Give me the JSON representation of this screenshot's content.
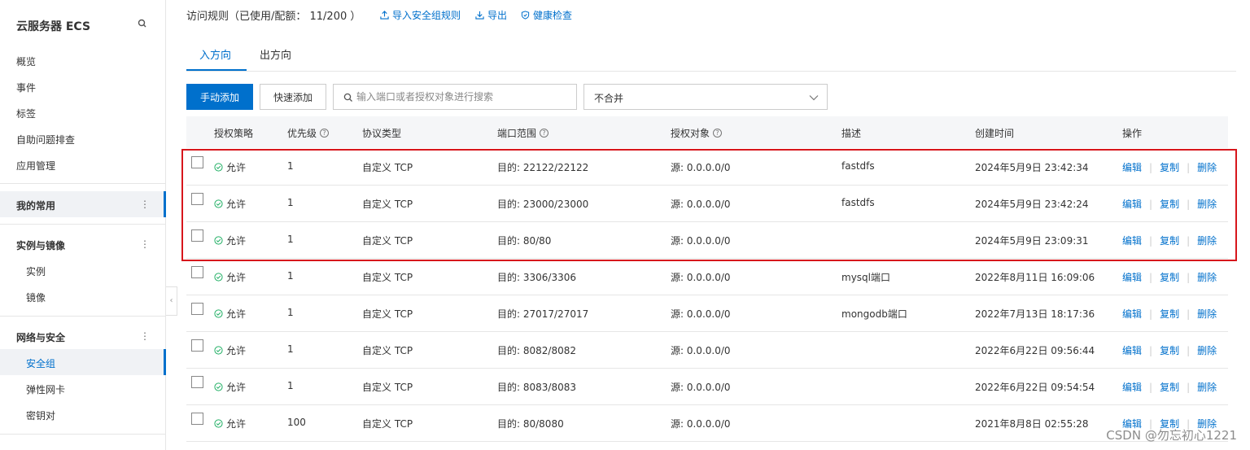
{
  "sidebar": {
    "title": "云服务器 ECS",
    "items": [
      "概览",
      "事件",
      "标签",
      "自助问题排查",
      "应用管理"
    ],
    "favorites": "我的常用",
    "group1": {
      "label": "实例与镜像",
      "items": [
        "实例",
        "镜像"
      ]
    },
    "group2": {
      "label": "网络与安全",
      "items": [
        "安全组",
        "弹性网卡",
        "密钥对"
      ]
    }
  },
  "header": {
    "title": "访问规则（已使用/配额： 11/200 ）",
    "links": [
      "导入安全组规则",
      "导出",
      "健康检查"
    ]
  },
  "tabs": [
    "入方向",
    "出方向"
  ],
  "toolbar": {
    "add_manual": "手动添加",
    "add_quick": "快速添加",
    "search_placeholder": "输入端口或者授权对象进行搜索",
    "merge_select": "不合并"
  },
  "table": {
    "headers": [
      "授权策略",
      "优先级",
      "协议类型",
      "端口范围",
      "授权对象",
      "描述",
      "创建时间",
      "操作"
    ],
    "actions": [
      "编辑",
      "复制",
      "删除"
    ],
    "rows": [
      {
        "policy": "允许",
        "priority": "1",
        "protocol": "自定义 TCP",
        "port": "目的: 22122/22122",
        "source": "源: 0.0.0.0/0",
        "desc": "fastdfs",
        "time": "2024年5月9日 23:42:34"
      },
      {
        "policy": "允许",
        "priority": "1",
        "protocol": "自定义 TCP",
        "port": "目的: 23000/23000",
        "source": "源: 0.0.0.0/0",
        "desc": "fastdfs",
        "time": "2024年5月9日 23:42:24"
      },
      {
        "policy": "允许",
        "priority": "1",
        "protocol": "自定义 TCP",
        "port": "目的: 80/80",
        "source": "源: 0.0.0.0/0",
        "desc": "",
        "time": "2024年5月9日 23:09:31"
      },
      {
        "policy": "允许",
        "priority": "1",
        "protocol": "自定义 TCP",
        "port": "目的: 3306/3306",
        "source": "源: 0.0.0.0/0",
        "desc": "mysql端口",
        "time": "2022年8月11日 16:09:06"
      },
      {
        "policy": "允许",
        "priority": "1",
        "protocol": "自定义 TCP",
        "port": "目的: 27017/27017",
        "source": "源: 0.0.0.0/0",
        "desc": "mongodb端口",
        "time": "2022年7月13日 18:17:36"
      },
      {
        "policy": "允许",
        "priority": "1",
        "protocol": "自定义 TCP",
        "port": "目的: 8082/8082",
        "source": "源: 0.0.0.0/0",
        "desc": "",
        "time": "2022年6月22日 09:56:44"
      },
      {
        "policy": "允许",
        "priority": "1",
        "protocol": "自定义 TCP",
        "port": "目的: 8083/8083",
        "source": "源: 0.0.0.0/0",
        "desc": "",
        "time": "2022年6月22日 09:54:54"
      },
      {
        "policy": "允许",
        "priority": "100",
        "protocol": "自定义 TCP",
        "port": "目的: 80/8080",
        "source": "源: 0.0.0.0/0",
        "desc": "",
        "time": "2021年8月8日 02:55:28"
      }
    ]
  },
  "watermark": "CSDN @勿忘初心1221",
  "colors": {
    "primary": "#0070cc",
    "highlight": "#d7161c",
    "success": "#23b066"
  }
}
